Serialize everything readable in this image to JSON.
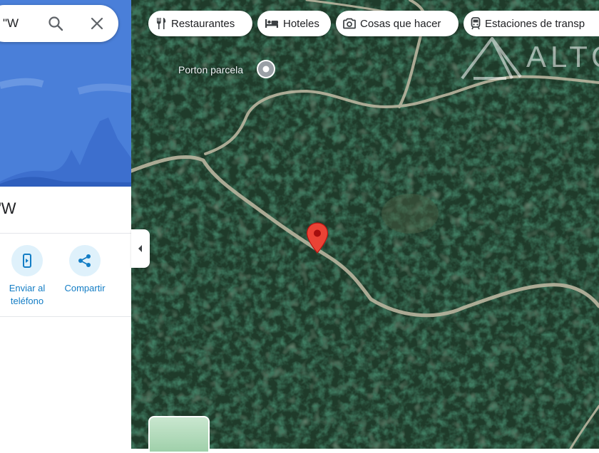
{
  "search": {
    "query": "\"W"
  },
  "panel": {
    "coordinates_title": "\"W",
    "actions": [
      {
        "label_line1": "Enviar al",
        "label_line2": "teléfono",
        "icon": "phone-send-icon"
      },
      {
        "label": "Compartir",
        "icon": "share-icon"
      }
    ]
  },
  "chips": [
    {
      "label": "Restaurantes",
      "icon": "fork-knife-icon"
    },
    {
      "label": "Hoteles",
      "icon": "bed-icon"
    },
    {
      "label": "Cosas que hacer",
      "icon": "camera-icon"
    },
    {
      "label": "Estaciones de transp",
      "icon": "train-icon"
    }
  ],
  "map": {
    "place_label": "Porton parcela",
    "view": "satellite",
    "watermark": "ALTO"
  },
  "colors": {
    "accent_blue": "#1a73e8",
    "pin_red": "#ea4335",
    "panel_hero": "#4a7fd9"
  }
}
